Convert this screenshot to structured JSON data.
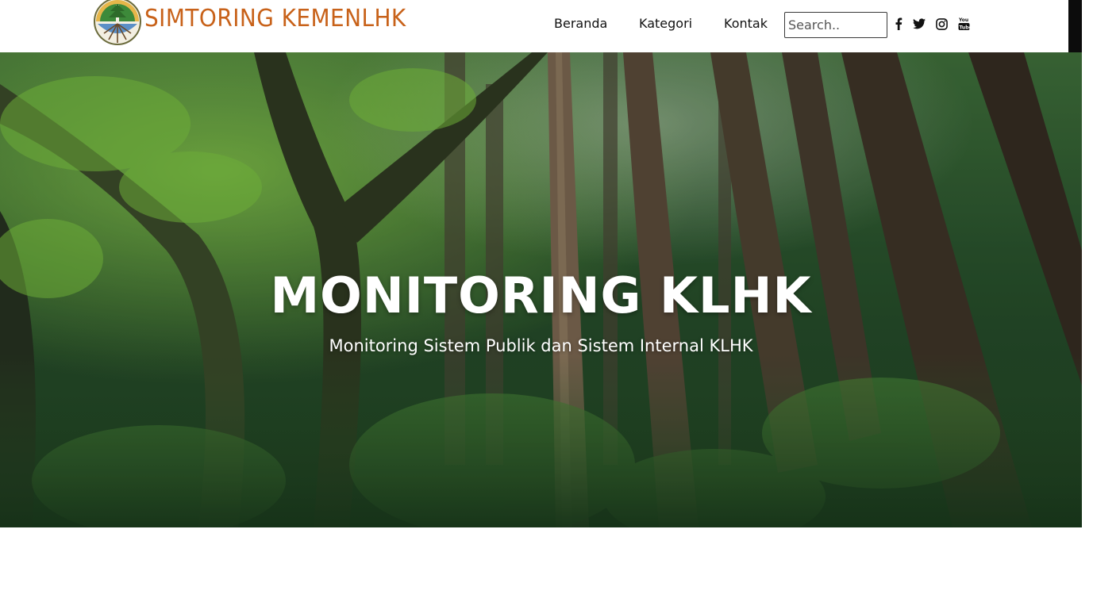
{
  "brand": {
    "name": "SIMTORING KEMENLHK",
    "color": "#c8621a"
  },
  "nav": {
    "links": [
      "Beranda",
      "Kategori",
      "Kontak"
    ],
    "search_placeholder": "Search..",
    "social_icons": [
      "facebook-icon",
      "twitter-icon",
      "instagram-icon",
      "youtube-icon"
    ]
  },
  "hero": {
    "title": "MONITORING KLHK",
    "subtitle": "Monitoring Sistem Publik dan Sistem Internal KLHK"
  }
}
